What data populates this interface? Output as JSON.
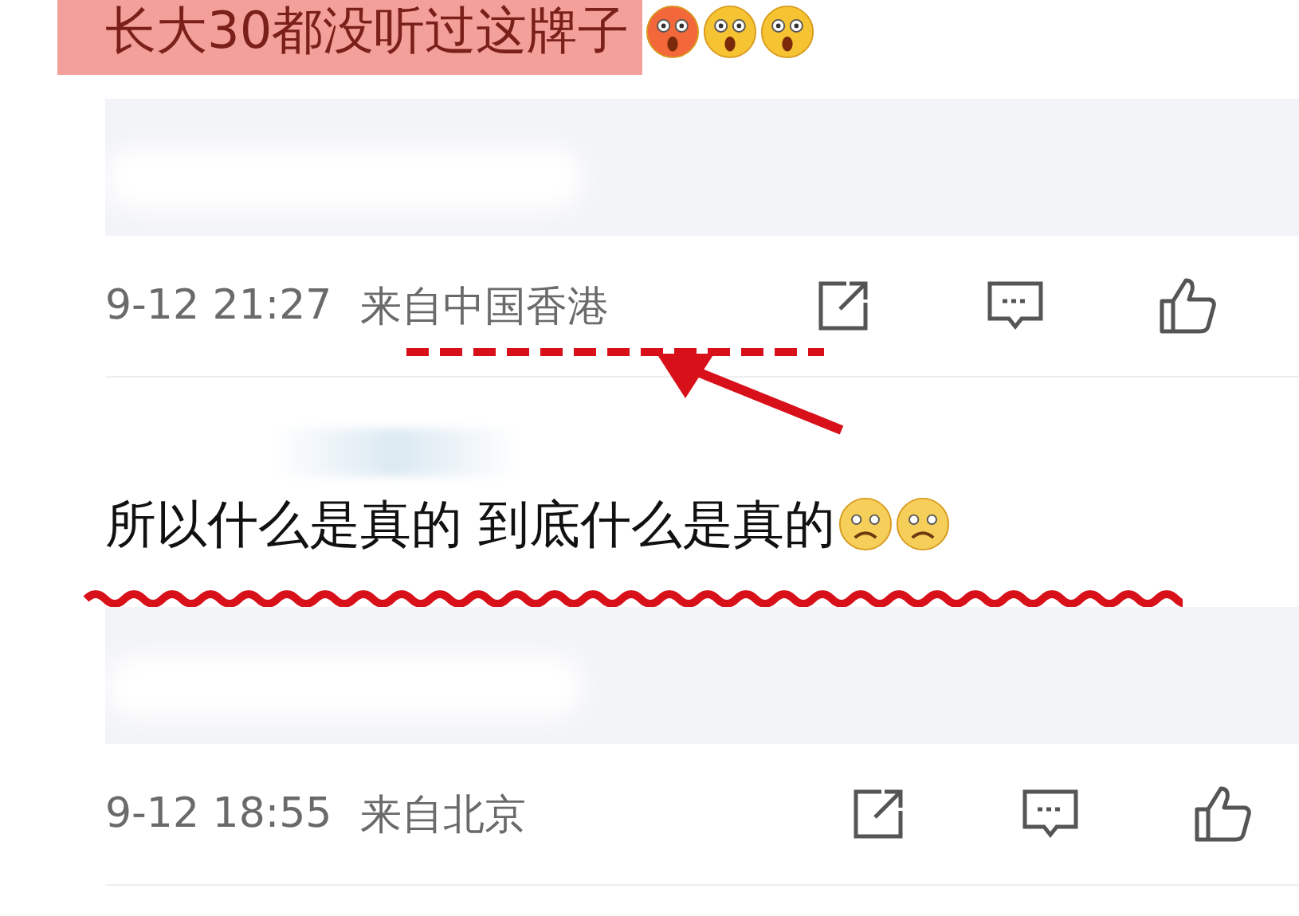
{
  "feed": [
    {
      "kind": "comment",
      "text": "长大30都没听过这牌子",
      "highlighted": true,
      "wavy_underline": false,
      "emojis": [
        {
          "kind": "angry"
        },
        {
          "kind": "shocked"
        },
        {
          "kind": "shocked"
        }
      ]
    },
    {
      "kind": "quote"
    },
    {
      "kind": "meta",
      "time": "9-12 21:27",
      "location": "来自中国香港",
      "location_marked": true
    },
    {
      "kind": "user"
    },
    {
      "kind": "comment",
      "text": "所以什么是真的 到底什么是真的",
      "highlighted": false,
      "wavy_underline": true,
      "emojis": [
        {
          "kind": "worried"
        },
        {
          "kind": "worried"
        }
      ]
    },
    {
      "kind": "quote"
    },
    {
      "kind": "meta",
      "time": "9-12 18:55",
      "location": "来自北京",
      "location_marked": false
    }
  ]
}
